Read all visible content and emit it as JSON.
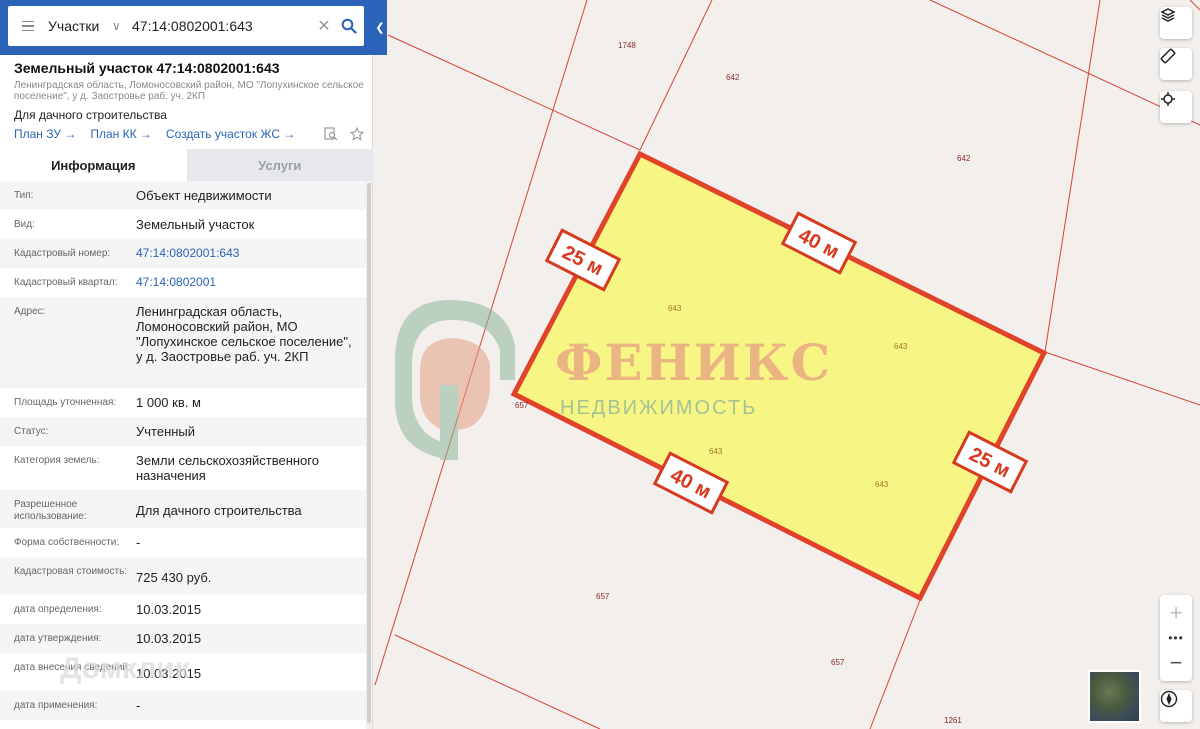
{
  "search": {
    "mode": "Участки",
    "value": "47:14:0802001:643"
  },
  "object": {
    "title": "Земельный участок 47:14:0802001:643",
    "address": "Ленинградская область, Ломоносовский район, МО \"Лопухинское сельское поселение\", у д. Заостровье раб. уч. 2КП",
    "use": "Для дачного строительства",
    "links": [
      "План ЗУ →",
      "План КК →",
      "Создать участок ЖС →"
    ]
  },
  "tabs": [
    "Информация",
    "Услуги"
  ],
  "info": [
    {
      "key": "Тип:",
      "value": "Объект недвижимости"
    },
    {
      "key": "Вид:",
      "value": "Земельный участок"
    },
    {
      "key": "Кадастровый номер:",
      "value": "47:14:0802001:643"
    },
    {
      "key": "Кадастровый квартал:",
      "value": "47:14:0802001"
    },
    {
      "key": "Адрес:",
      "value": "Ленинградская область, Ломоносовский район, МО \"Лопухинское сельское поселение\", у д. Заостровье раб. уч. 2КП"
    },
    {
      "key": "Площадь уточненная:",
      "value": "1 000 кв. м"
    },
    {
      "key": "Статус:",
      "value": "Учтенный"
    },
    {
      "key": "Категория земель:",
      "value": "Земли сельскохозяйственного назначения"
    },
    {
      "key": "Разрешенное использование:",
      "value": "Для дачного строительства"
    },
    {
      "key": "Форма собственности:",
      "value": "-"
    },
    {
      "key": "Кадастровая стоимость:",
      "value": "725 430 руб."
    },
    {
      "key": "дата определения:",
      "value": "10.03.2015"
    },
    {
      "key": "дата утверждения:",
      "value": "10.03.2015"
    },
    {
      "key": "дата внесения сведений:",
      "value": "10.03.2015"
    },
    {
      "key": "дата применения:",
      "value": "-"
    }
  ],
  "map": {
    "parcel_labels": [
      "1748",
      "642",
      "642",
      "643",
      "643",
      "643",
      "643",
      "657",
      "657",
      "657",
      "1261"
    ],
    "dimensions": [
      "25 м",
      "40 м",
      "40 м",
      "25 м"
    ],
    "watermark_title": "ФЕНИКС",
    "watermark_sub": "НЕДВИЖИМОСТЬ",
    "watermark_corner": "Домклик",
    "zoom_in": "+",
    "zoom_more": "•••",
    "zoom_out": "−"
  },
  "colors": {
    "brand": "#2a63b8",
    "parcel_fill": "#f7f57a",
    "parcel_stroke": "#e0432a",
    "boundary": "#d6453a"
  }
}
